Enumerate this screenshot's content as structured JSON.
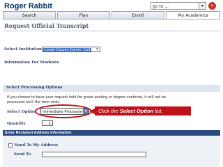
{
  "header": {
    "user_name": "Roger Rabbit",
    "goto_value": "go to ...",
    "goto_arrow": "▾",
    "go_button": "»"
  },
  "tabs": [
    {
      "label": "Search"
    },
    {
      "label": "Plan"
    },
    {
      "label": "Enroll"
    },
    {
      "label": "My Academics",
      "active": true
    }
  ],
  "page": {
    "title": "Request Official Transcript"
  },
  "institution": {
    "label": "Select Institution",
    "value": "Lorain County Comm. Coll",
    "arrow": "▾"
  },
  "info": {
    "label": "Information For Students"
  },
  "processing": {
    "section_title": "Select Processing Options",
    "note": "If you choose to have your request held for grade posting or degree conferral, it will not be processed until the term ends.",
    "option_label": "Select Option",
    "option_value": "Immediate Processing",
    "option_arrow": "▾",
    "quantity_label": "Quantity",
    "quantity_value": "1"
  },
  "callout": {
    "prefix": "Click the ",
    "emphasis": "Select Option",
    "suffix": " list."
  },
  "address": {
    "section_title": "Enter Recipient Address Information",
    "send_to_my_address_label": "Send To My Address",
    "send_to_label": "Send To"
  },
  "colors": {
    "header_text": "#003366",
    "callout": "#c0121b",
    "address_bar": "#2b4a80"
  }
}
